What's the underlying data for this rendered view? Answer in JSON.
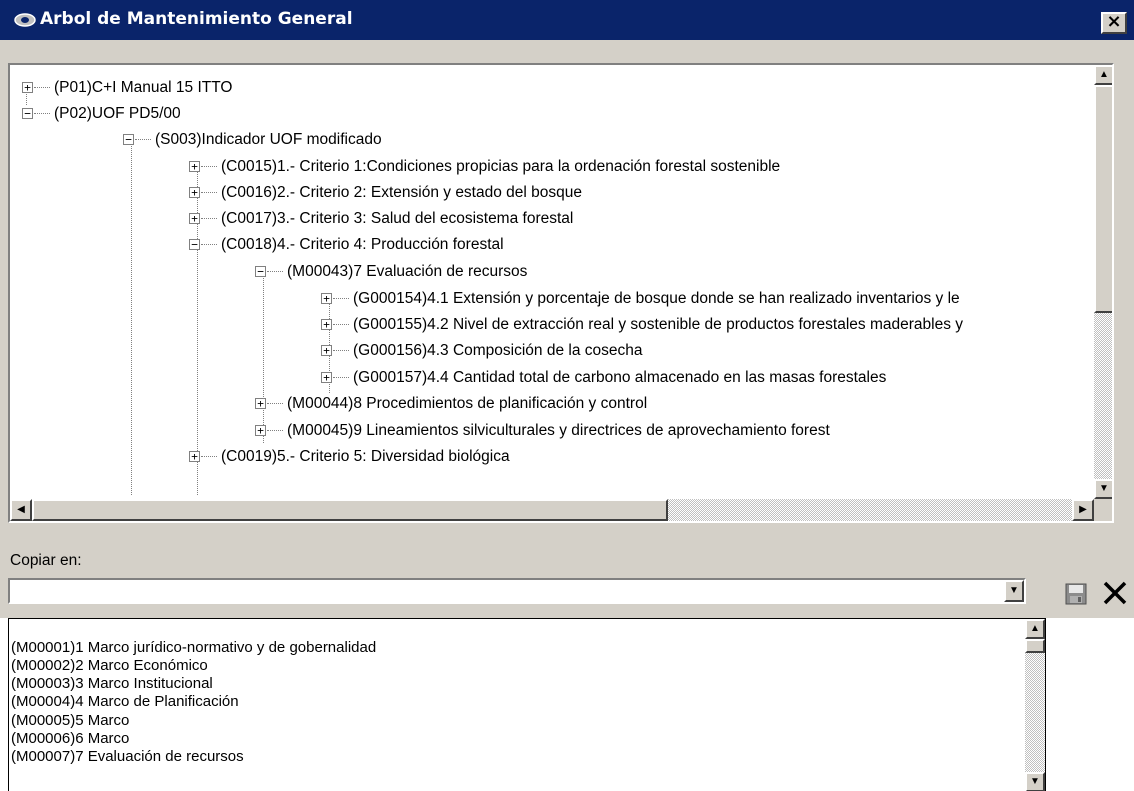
{
  "window": {
    "title": "Arbol de Mantenimiento General",
    "close_label": "×"
  },
  "tree": {
    "nodes": [
      {
        "label": "(P01)C+I Manual 15 ITTO",
        "expander": "+"
      },
      {
        "label": "(P02)UOF PD5/00",
        "expander": "−"
      },
      {
        "label": "(S003)Indicador UOF modificado",
        "expander": "−"
      },
      {
        "label": "(C0015)1.- Criterio 1:Condiciones propicias para la ordenación forestal sostenible",
        "expander": "+"
      },
      {
        "label": "(C0016)2.- Criterio 2: Extensión y estado del bosque",
        "expander": "+"
      },
      {
        "label": "(C0017)3.- Criterio 3: Salud del ecosistema forestal",
        "expander": "+"
      },
      {
        "label": "(C0018)4.- Criterio 4: Producción forestal",
        "expander": "−"
      },
      {
        "label": "(M00043)7 Evaluación de recursos",
        "expander": "−"
      },
      {
        "label": "(G000154)4.1 Extensión y porcentaje de bosque donde se han realizado inventarios y le",
        "expander": "+"
      },
      {
        "label": "(G000155)4.2 Nivel de extracción real y sostenible de productos forestales maderables y",
        "expander": "+"
      },
      {
        "label": "(G000156)4.3 Composición de la cosecha",
        "expander": "+"
      },
      {
        "label": "(G000157)4.4 Cantidad total de carbono almacenado en las masas forestales",
        "expander": "+"
      },
      {
        "label": "(M00044)8 Procedimientos de planificación y control",
        "expander": "+"
      },
      {
        "label": "(M00045)9 Lineamientos silviculturales y directrices de aprovechamiento forest",
        "expander": "+"
      },
      {
        "label": "(C0019)5.- Criterio 5: Diversidad biológica",
        "expander": "+"
      }
    ]
  },
  "copy": {
    "label": "Copiar en:",
    "value": ""
  },
  "dropdown": {
    "items": [
      "(M00001)1 Marco jurídico-normativo y de gobernalidad",
      "(M00002)2 Marco Económico",
      "(M00003)3 Marco Institucional",
      "(M00004)4 Marco de Planificación",
      "(M00005)5 Marco",
      "(M00006)6 Marco",
      "(M00007)7 Evaluación de recursos"
    ]
  },
  "icons": {
    "app": "app-icon",
    "save": "save-icon",
    "cancel": "cancel-x-icon"
  },
  "colors": {
    "titlebar": "#0a246a",
    "window_bg": "#d4d0c8"
  }
}
